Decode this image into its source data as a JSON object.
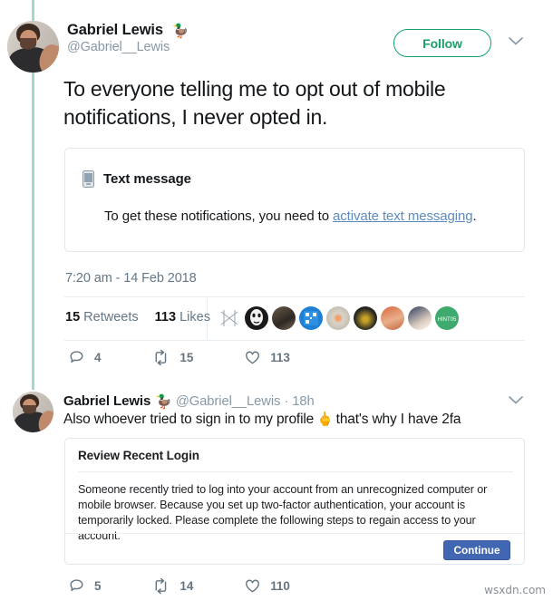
{
  "thread": {
    "top_partial_text": "",
    "main_tweet": {
      "display_name": "Gabriel Lewis",
      "name_emoji": "🦆",
      "handle": "@Gabriel__Lewis",
      "follow_label": "Follow",
      "more_icon": "chevron-down-icon",
      "avatar_label": "gabriel-lewis-avatar",
      "text": "To everyone telling me to opt out of mobile notifications, I never opted in.",
      "embedded_card": {
        "icon": "mobile-phone-icon",
        "title": "Text message",
        "body_prefix": "To get these notifications, you need to ",
        "body_link": "activate text messaging",
        "body_suffix": "."
      },
      "timestamp": "7:20 am - 14 Feb 2018",
      "stats": {
        "retweets_count": "15",
        "retweets_label": "Retweets",
        "likes_count": "113",
        "likes_label": "Likes"
      },
      "actions": {
        "reply_count": "4",
        "retweet_count": "15",
        "like_count": "113"
      }
    },
    "reply_tweet": {
      "display_name": "Gabriel Lewis",
      "name_emoji": "🦆",
      "handle": "@Gabriel__Lewis",
      "time_ago": "18h",
      "separator": "·",
      "more_icon": "chevron-down-icon",
      "avatar_label": "gabriel-lewis-avatar",
      "text_before_emoji": "Also whoever tried to sign in to my profile",
      "text_emoji": "🖕",
      "text_after_emoji": "that's why I have 2fa",
      "login_card": {
        "title": "Review Recent Login",
        "body": "Someone recently tried to log into your account from an unrecognized computer or mobile browser. Because you set up two-factor authentication, your account is temporarily locked. Please complete the following steps to regain access to your account.",
        "continue_label": "Continue"
      },
      "actions": {
        "reply_count": "5",
        "retweet_count": "14",
        "like_count": "110"
      }
    }
  },
  "watermark": "wsxdn.com",
  "colors": {
    "follow_green": "#17a06a",
    "thread_line": "#9fdcc2",
    "link_blue": "#5b8bbf",
    "continue_blue": "#4267b2",
    "muted_text": "#657786",
    "primary_text": "#14171a"
  }
}
